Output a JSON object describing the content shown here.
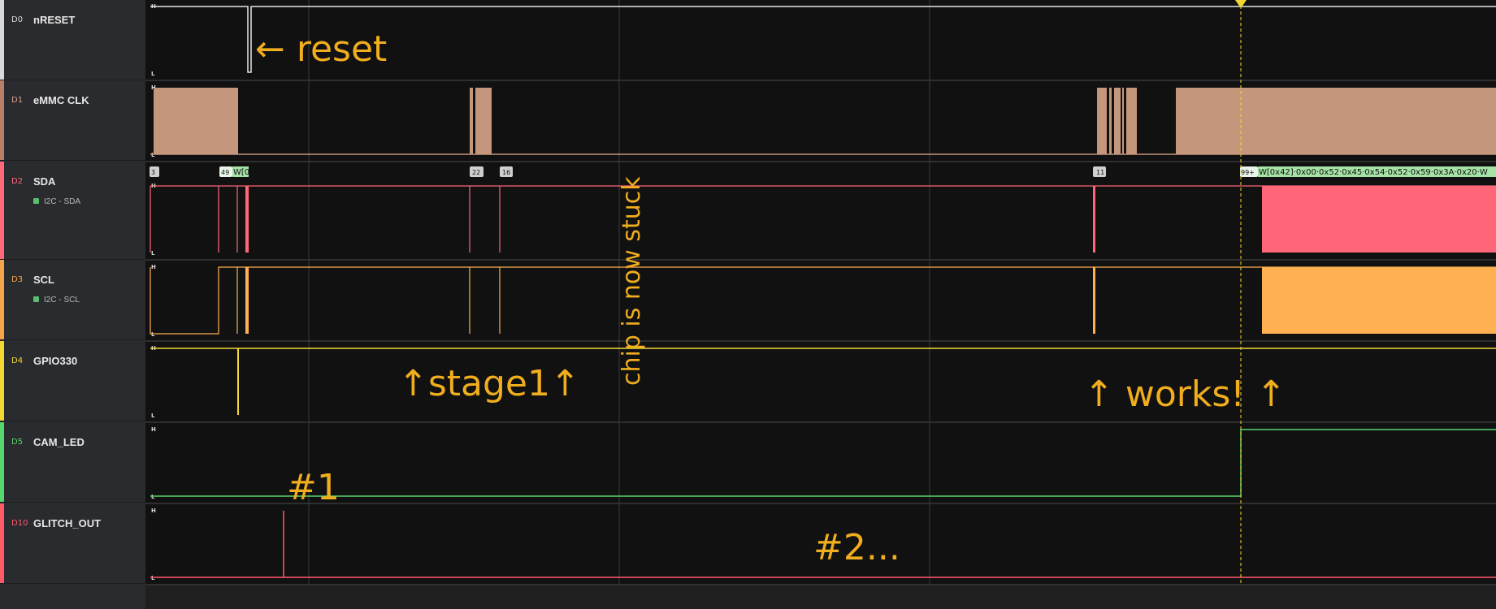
{
  "channels": [
    {
      "id": "D0",
      "name": "nRESET",
      "color": "#d9d9d9",
      "sub": null
    },
    {
      "id": "D1",
      "name": "eMMC CLK",
      "color": "#b8806a",
      "sub": null
    },
    {
      "id": "D2",
      "name": "SDA",
      "color": "#ff6a7a",
      "sub": "I2C - SDA"
    },
    {
      "id": "D3",
      "name": "SCL",
      "color": "#f5a54a",
      "sub": "I2C - SCL"
    },
    {
      "id": "D4",
      "name": "GPIO330",
      "color": "#f3d732",
      "sub": null
    },
    {
      "id": "D5",
      "name": "CAM_LED",
      "color": "#57d66e",
      "sub": null
    },
    {
      "id": "D10",
      "name": "GLITCH_OUT",
      "color": "#ff5a6a",
      "sub": null
    }
  ],
  "level_labels": {
    "high": "H",
    "low": "L"
  },
  "i2c_frames": [
    "3",
    "49",
    "W[0",
    "22",
    "16",
    "11",
    "99+",
    "W[0x42]·0x00·0x52·0x45·0x54·0x52·0x59·0x3A·0x20·W"
  ],
  "annotations": {
    "reset": "← reset",
    "stuck": "chip is now stuck",
    "stage1": "↑stage1↑",
    "works": "↑ works! ↑",
    "glitch1": "#1",
    "glitch2": "#2..."
  },
  "colors": {
    "annotation": "#f0ad1e",
    "clk_fill": "#c4967c",
    "sda_fill": "#ff6677",
    "scl_fill": "#ffb052",
    "frame_green": "#a6e3a6",
    "background": "#111111"
  }
}
